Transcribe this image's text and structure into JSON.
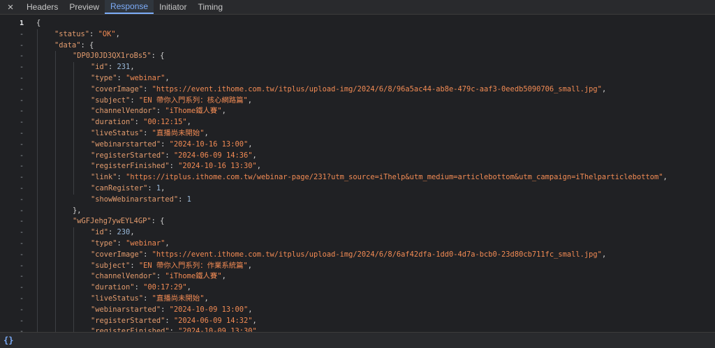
{
  "tabs": {
    "close_icon": "×",
    "items": [
      {
        "label": "Headers",
        "active": false
      },
      {
        "label": "Preview",
        "active": false
      },
      {
        "label": "Response",
        "active": true
      },
      {
        "label": "Initiator",
        "active": false
      },
      {
        "label": "Timing",
        "active": false
      }
    ]
  },
  "gutter": {
    "first": "1",
    "other": "-"
  },
  "code_lines": [
    {
      "indent": 0,
      "tokens": [
        [
          "p",
          "{"
        ]
      ]
    },
    {
      "indent": 1,
      "tokens": [
        [
          "k",
          "\"status\""
        ],
        [
          "p",
          ": "
        ],
        [
          "s",
          "\"OK\""
        ],
        [
          "p",
          ","
        ]
      ]
    },
    {
      "indent": 1,
      "tokens": [
        [
          "k",
          "\"data\""
        ],
        [
          "p",
          ": {"
        ]
      ]
    },
    {
      "indent": 2,
      "tokens": [
        [
          "k",
          "\"DP0J0JD3QX1roBs5\""
        ],
        [
          "p",
          ": {"
        ]
      ]
    },
    {
      "indent": 3,
      "tokens": [
        [
          "k",
          "\"id\""
        ],
        [
          "p",
          ": "
        ],
        [
          "n",
          "231"
        ],
        [
          "p",
          ","
        ]
      ]
    },
    {
      "indent": 3,
      "tokens": [
        [
          "k",
          "\"type\""
        ],
        [
          "p",
          ": "
        ],
        [
          "s",
          "\"webinar\""
        ],
        [
          "p",
          ","
        ]
      ]
    },
    {
      "indent": 3,
      "tokens": [
        [
          "k",
          "\"coverImage\""
        ],
        [
          "p",
          ": "
        ],
        [
          "s",
          "\"https://event.ithome.com.tw/itplus/upload-img/2024/6/8/96a5ac44-ab8e-479c-aaf3-0eedb5090706_small.jpg\""
        ],
        [
          "p",
          ","
        ]
      ]
    },
    {
      "indent": 3,
      "tokens": [
        [
          "k",
          "\"subject\""
        ],
        [
          "p",
          ": "
        ],
        [
          "s",
          "\"EN 帶你入門系列：核心網路篇\""
        ],
        [
          "p",
          ","
        ]
      ]
    },
    {
      "indent": 3,
      "tokens": [
        [
          "k",
          "\"channelVendor\""
        ],
        [
          "p",
          ": "
        ],
        [
          "s",
          "\"iThome鐵人賽\""
        ],
        [
          "p",
          ","
        ]
      ]
    },
    {
      "indent": 3,
      "tokens": [
        [
          "k",
          "\"duration\""
        ],
        [
          "p",
          ": "
        ],
        [
          "s",
          "\"00:12:15\""
        ],
        [
          "p",
          ","
        ]
      ]
    },
    {
      "indent": 3,
      "tokens": [
        [
          "k",
          "\"liveStatus\""
        ],
        [
          "p",
          ": "
        ],
        [
          "s",
          "\"直播尚未開始\""
        ],
        [
          "p",
          ","
        ]
      ]
    },
    {
      "indent": 3,
      "tokens": [
        [
          "k",
          "\"webinarstarted\""
        ],
        [
          "p",
          ": "
        ],
        [
          "s",
          "\"2024-10-16 13:00\""
        ],
        [
          "p",
          ","
        ]
      ]
    },
    {
      "indent": 3,
      "tokens": [
        [
          "k",
          "\"registerStarted\""
        ],
        [
          "p",
          ": "
        ],
        [
          "s",
          "\"2024-06-09 14:36\""
        ],
        [
          "p",
          ","
        ]
      ]
    },
    {
      "indent": 3,
      "tokens": [
        [
          "k",
          "\"registerFinished\""
        ],
        [
          "p",
          ": "
        ],
        [
          "s",
          "\"2024-10-16 13:30\""
        ],
        [
          "p",
          ","
        ]
      ]
    },
    {
      "indent": 3,
      "tokens": [
        [
          "k",
          "\"link\""
        ],
        [
          "p",
          ": "
        ],
        [
          "s",
          "\"https://itplus.ithome.com.tw/webinar-page/231?utm_source=iThelp&utm_medium=articlebottom&utm_campaign=iThelparticlebottom\""
        ],
        [
          "p",
          ","
        ]
      ]
    },
    {
      "indent": 3,
      "tokens": [
        [
          "k",
          "\"canRegister\""
        ],
        [
          "p",
          ": "
        ],
        [
          "n",
          "1"
        ],
        [
          "p",
          ","
        ]
      ]
    },
    {
      "indent": 3,
      "tokens": [
        [
          "k",
          "\"showWebinarstarted\""
        ],
        [
          "p",
          ": "
        ],
        [
          "n",
          "1"
        ]
      ]
    },
    {
      "indent": 2,
      "tokens": [
        [
          "p",
          "},"
        ]
      ]
    },
    {
      "indent": 2,
      "tokens": [
        [
          "k",
          "\"wGFJehg7ywEYL4GP\""
        ],
        [
          "p",
          ": {"
        ]
      ]
    },
    {
      "indent": 3,
      "tokens": [
        [
          "k",
          "\"id\""
        ],
        [
          "p",
          ": "
        ],
        [
          "n",
          "230"
        ],
        [
          "p",
          ","
        ]
      ]
    },
    {
      "indent": 3,
      "tokens": [
        [
          "k",
          "\"type\""
        ],
        [
          "p",
          ": "
        ],
        [
          "s",
          "\"webinar\""
        ],
        [
          "p",
          ","
        ]
      ]
    },
    {
      "indent": 3,
      "tokens": [
        [
          "k",
          "\"coverImage\""
        ],
        [
          "p",
          ": "
        ],
        [
          "s",
          "\"https://event.ithome.com.tw/itplus/upload-img/2024/6/8/6af42dfa-1dd0-4d7a-bcb0-23d80cb711fc_small.jpg\""
        ],
        [
          "p",
          ","
        ]
      ]
    },
    {
      "indent": 3,
      "tokens": [
        [
          "k",
          "\"subject\""
        ],
        [
          "p",
          ": "
        ],
        [
          "s",
          "\"EN 帶你入門系列：作業系統篇\""
        ],
        [
          "p",
          ","
        ]
      ]
    },
    {
      "indent": 3,
      "tokens": [
        [
          "k",
          "\"channelVendor\""
        ],
        [
          "p",
          ": "
        ],
        [
          "s",
          "\"iThome鐵人賽\""
        ],
        [
          "p",
          ","
        ]
      ]
    },
    {
      "indent": 3,
      "tokens": [
        [
          "k",
          "\"duration\""
        ],
        [
          "p",
          ": "
        ],
        [
          "s",
          "\"00:17:29\""
        ],
        [
          "p",
          ","
        ]
      ]
    },
    {
      "indent": 3,
      "tokens": [
        [
          "k",
          "\"liveStatus\""
        ],
        [
          "p",
          ": "
        ],
        [
          "s",
          "\"直播尚未開始\""
        ],
        [
          "p",
          ","
        ]
      ]
    },
    {
      "indent": 3,
      "tokens": [
        [
          "k",
          "\"webinarstarted\""
        ],
        [
          "p",
          ": "
        ],
        [
          "s",
          "\"2024-10-09 13:00\""
        ],
        [
          "p",
          ","
        ]
      ]
    },
    {
      "indent": 3,
      "tokens": [
        [
          "k",
          "\"registerStarted\""
        ],
        [
          "p",
          ": "
        ],
        [
          "s",
          "\"2024-06-09 14:32\""
        ],
        [
          "p",
          ","
        ]
      ]
    },
    {
      "indent": 3,
      "tokens": [
        [
          "k",
          "\"registerFinished\""
        ],
        [
          "p",
          ": "
        ],
        [
          "s",
          "\"2024-10-09 13:30\""
        ],
        [
          "p",
          ","
        ]
      ]
    }
  ],
  "statusbar": {
    "format_label": "{}"
  },
  "colors": {
    "background": "#202124",
    "key": "#e39c6e",
    "string": "#f28b54",
    "number": "#9bbbdc",
    "active_tab": "#7cacf8"
  }
}
